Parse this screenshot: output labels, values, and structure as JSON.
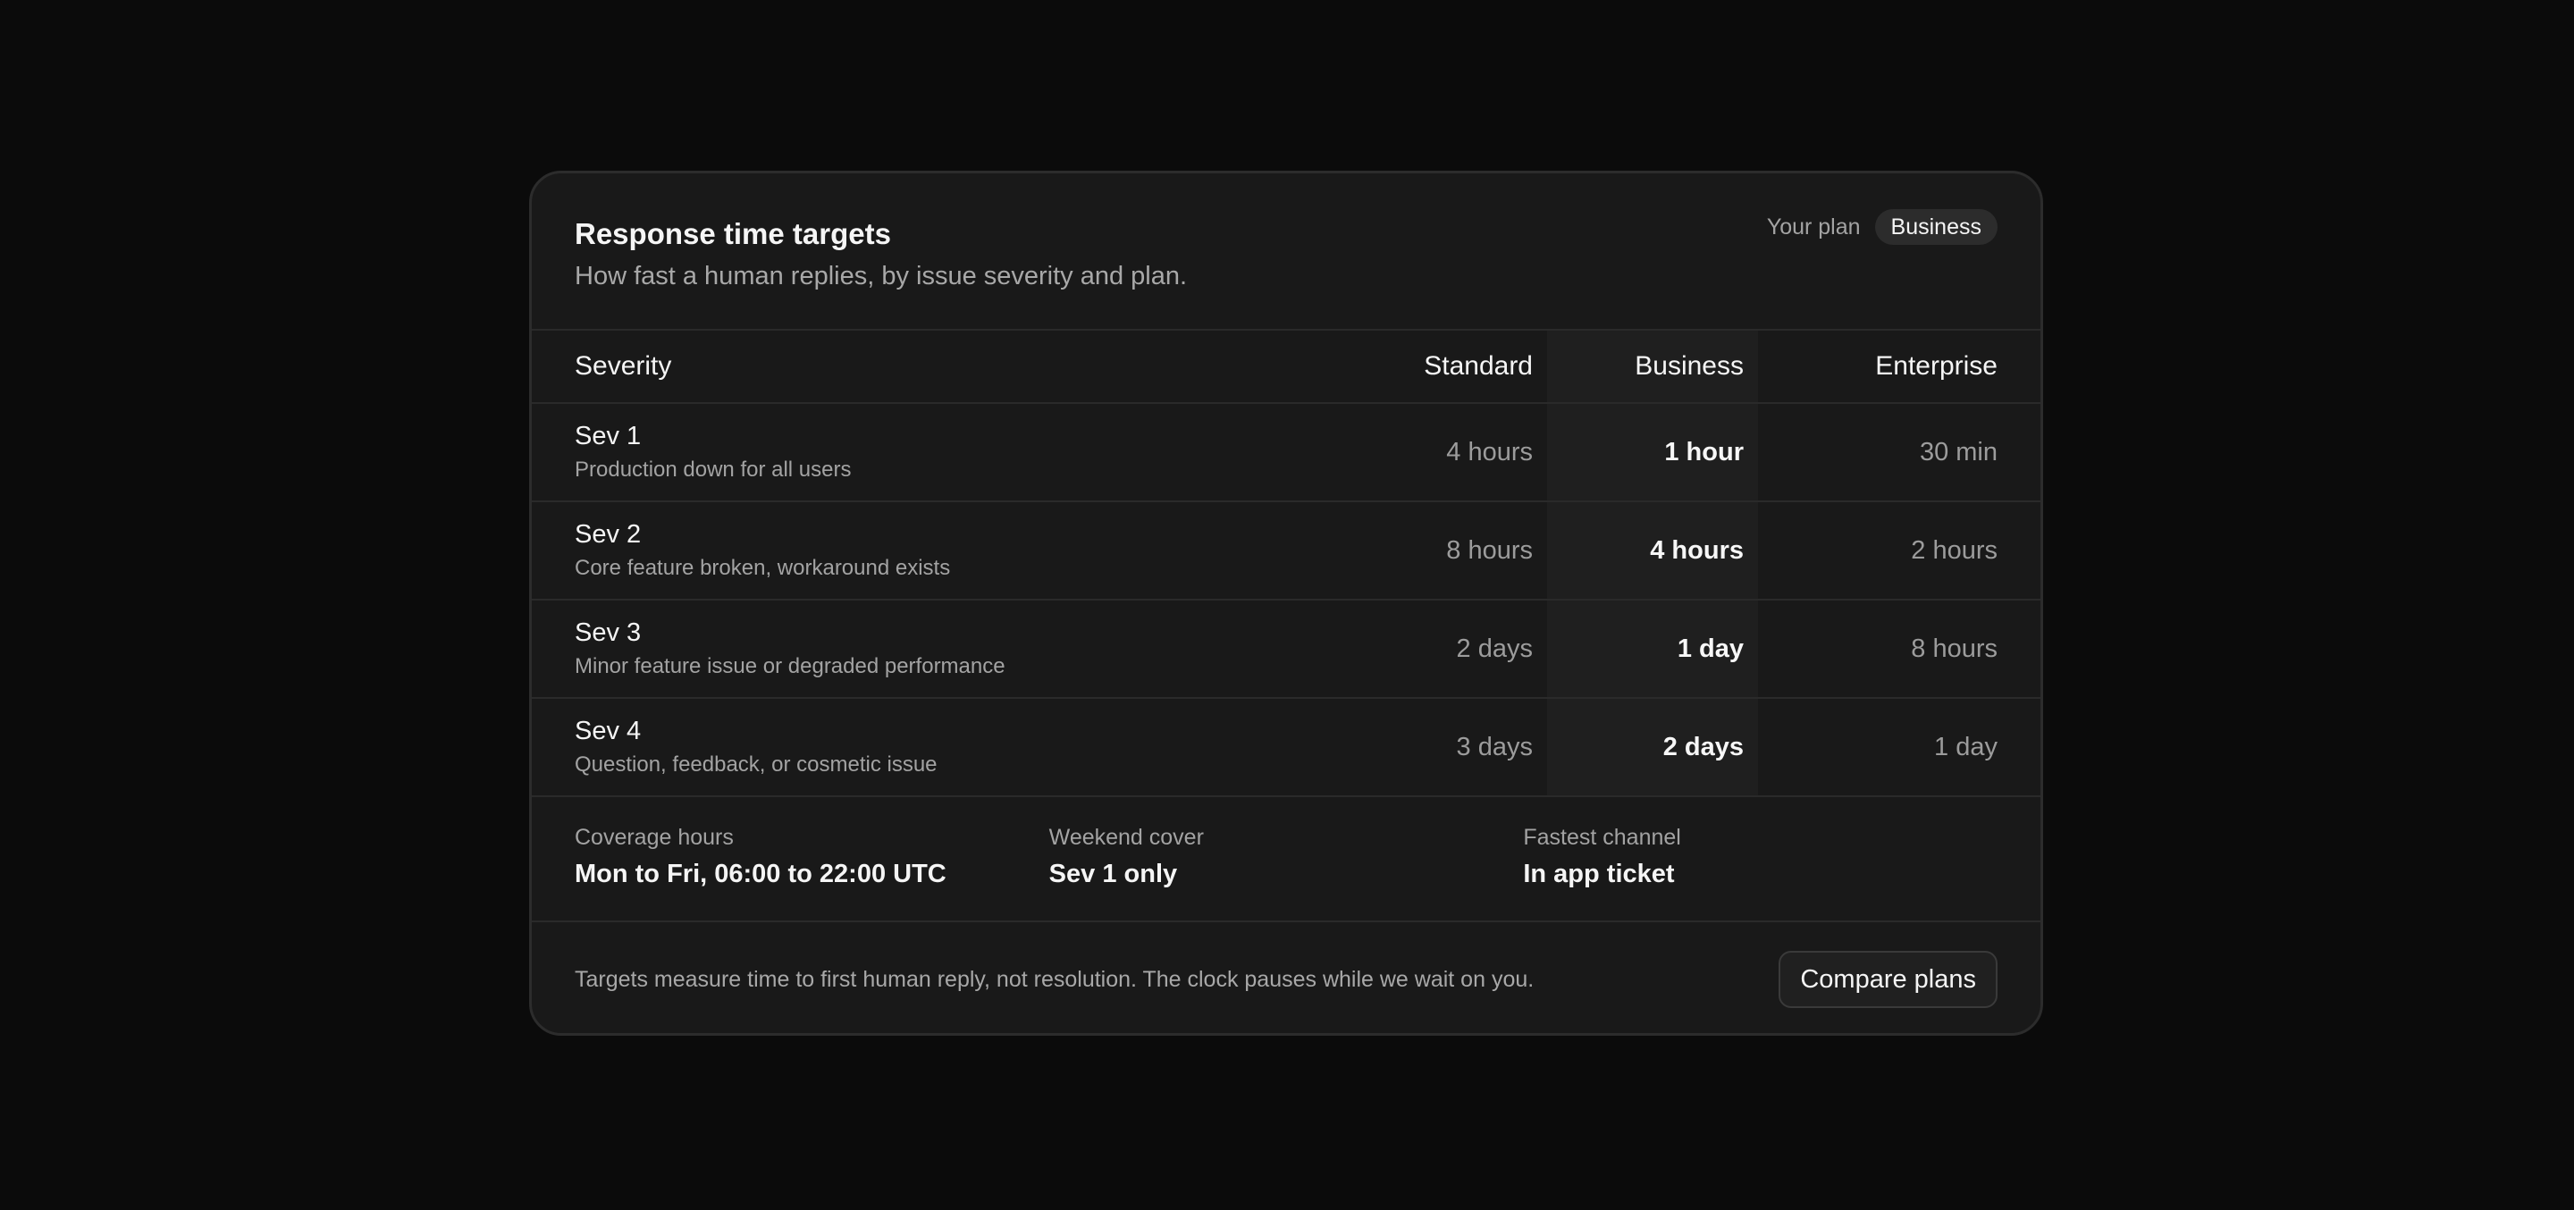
{
  "header": {
    "title": "Response time targets",
    "subtitle": "How fast a human replies, by issue severity and plan.",
    "plan_label": "Your plan",
    "plan_value": "Business"
  },
  "table": {
    "columns": [
      "Severity",
      "Standard",
      "Business",
      "Enterprise"
    ],
    "highlighted_column": "Business",
    "rows": [
      {
        "name": "Sev 1",
        "desc": "Production down for all users",
        "standard": "4 hours",
        "business": "1 hour",
        "enterprise": "30 min"
      },
      {
        "name": "Sev 2",
        "desc": "Core feature broken, workaround exists",
        "standard": "8 hours",
        "business": "4 hours",
        "enterprise": "2 hours"
      },
      {
        "name": "Sev 3",
        "desc": "Minor feature issue or degraded performance",
        "standard": "2 days",
        "business": "1 day",
        "enterprise": "8 hours"
      },
      {
        "name": "Sev 4",
        "desc": "Question, feedback, or cosmetic issue",
        "standard": "3 days",
        "business": "2 days",
        "enterprise": "1 day"
      }
    ]
  },
  "meta": [
    {
      "label": "Coverage hours",
      "value": "Mon to Fri, 06:00 to 22:00 UTC"
    },
    {
      "label": "Weekend cover",
      "value": "Sev 1 only"
    },
    {
      "label": "Fastest channel",
      "value": "In app ticket"
    }
  ],
  "footer": {
    "note": "Targets measure time to first human reply, not resolution. The clock pauses while we wait on you.",
    "button_label": "Compare plans"
  },
  "colors": {
    "background": "#0b0b0b",
    "card": "#191919",
    "highlight_column": "#1f1f1f",
    "muted_text": "#a3a3a3"
  }
}
